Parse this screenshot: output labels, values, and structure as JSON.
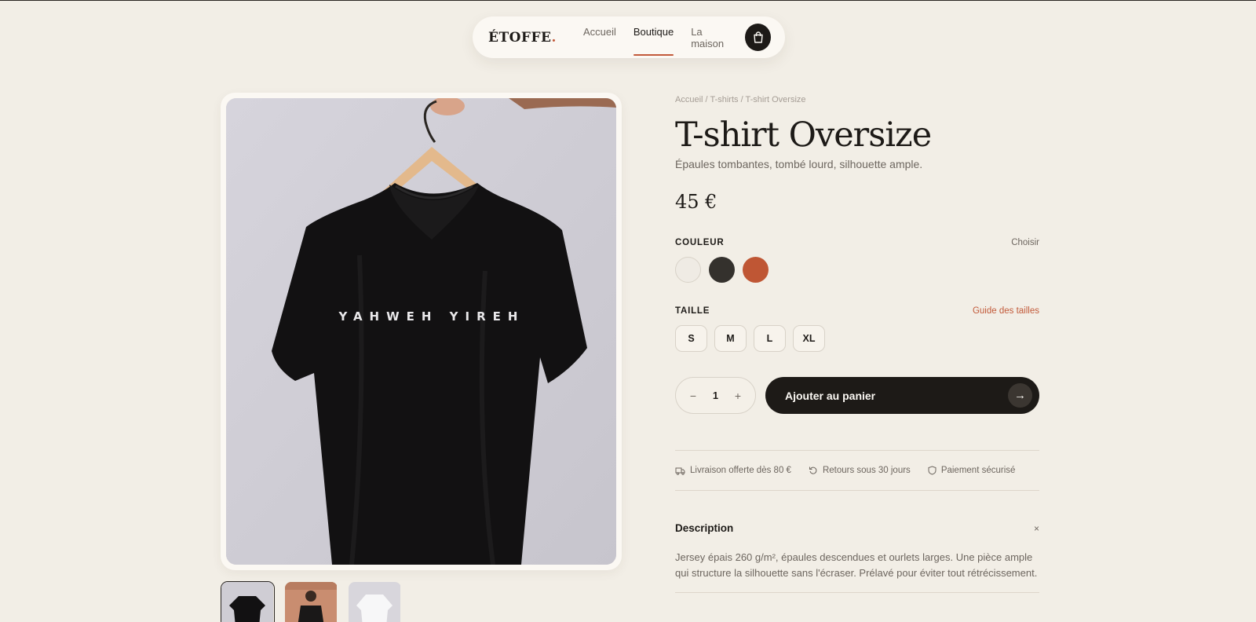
{
  "nav": {
    "brand": "ÉTOFFE",
    "brand_dot": ".",
    "links": [
      "Accueil",
      "Boutique",
      "La maison"
    ],
    "active_link": "Boutique",
    "cart_icon": "shopping-bag-icon"
  },
  "gallery": {
    "main_alt": "T-shirt noir sur cintre",
    "print_text": "YAHWEH YIREH",
    "thumbnails": [
      "t-shirt noir",
      "modèle",
      "t-shirt blanc"
    ],
    "active_thumbnail": 0
  },
  "breadcrumb": {
    "items": [
      "Accueil",
      "T-shirts",
      "T-shirt Oversize"
    ],
    "separator": "/"
  },
  "product": {
    "title": "T-shirt Oversize",
    "subtitle": "Épaules tombantes, tombé lourd, silhouette ample.",
    "price": "45 €"
  },
  "color": {
    "label": "COULEUR",
    "hint": "Choisir",
    "swatches": [
      "#efebe4",
      "#34312d",
      "#bf5634"
    ]
  },
  "size": {
    "label": "TAILLE",
    "guide": "Guide des tailles",
    "options": [
      "S",
      "M",
      "L",
      "XL"
    ]
  },
  "purchase": {
    "minus": "−",
    "quantity": "1",
    "plus": "+",
    "add_label": "Ajouter au panier",
    "arrow": "→"
  },
  "perks": [
    {
      "icon": "truck-icon",
      "label": "Livraison offerte dès 80 €"
    },
    {
      "icon": "return-icon",
      "label": "Retours sous 30 jours"
    },
    {
      "icon": "shield-icon",
      "label": "Paiement sécurisé"
    }
  ],
  "description": {
    "title": "Description",
    "close": "×",
    "text": "Jersey épais 260 g/m², épaules descendues et ourlets larges. Une pièce ample qui structure la silhouette sans l'écraser. Prélavé pour éviter tout rétrécissement."
  },
  "colors": {
    "background": "#f2eee6",
    "ink": "#1d1a17",
    "accent": "#c25a3a",
    "muted": "#6d665f"
  }
}
